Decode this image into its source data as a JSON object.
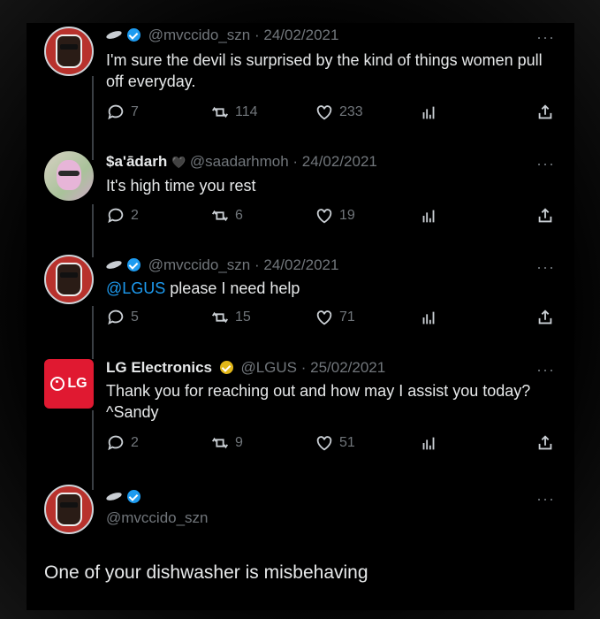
{
  "tweets": [
    {
      "handle": "@mvccido_szn",
      "date": "· 24/02/2021",
      "text": "I'm sure the devil is surprised by the kind of things women pull off everyday.",
      "replies": "7",
      "retweets": "114",
      "likes": "233"
    },
    {
      "name": "$a'ādarh",
      "handle": "@saadarhmoh",
      "date": "· 24/02/2021",
      "text": "It's high time you rest",
      "replies": "2",
      "retweets": "6",
      "likes": "19"
    },
    {
      "handle": "@mvccido_szn",
      "date": "· 24/02/2021",
      "mention": "@LGUS",
      "text": " please I need help",
      "replies": "5",
      "retweets": "15",
      "likes": "71"
    },
    {
      "name": "LG Electronics",
      "handle": "@LGUS",
      "date": "· 25/02/2021",
      "avatar_text": "LG",
      "text": "Thank you for reaching out and how may I assist you today?^Sandy",
      "replies": "2",
      "retweets": "9",
      "likes": "51"
    }
  ],
  "final": {
    "handle": "@mvccido_szn",
    "text": "One of your dishwasher is misbehaving"
  },
  "more_label": "···",
  "colors": {
    "background": "#000000",
    "verified": "#1d9bf0",
    "mention": "#1d9bf0",
    "lg_red": "#e01931",
    "gold_badge": "#e2b719"
  },
  "icons": [
    "reply-icon",
    "retweet-icon",
    "like-icon",
    "views-icon",
    "share-icon",
    "more-icon",
    "verified-badge-icon"
  ]
}
